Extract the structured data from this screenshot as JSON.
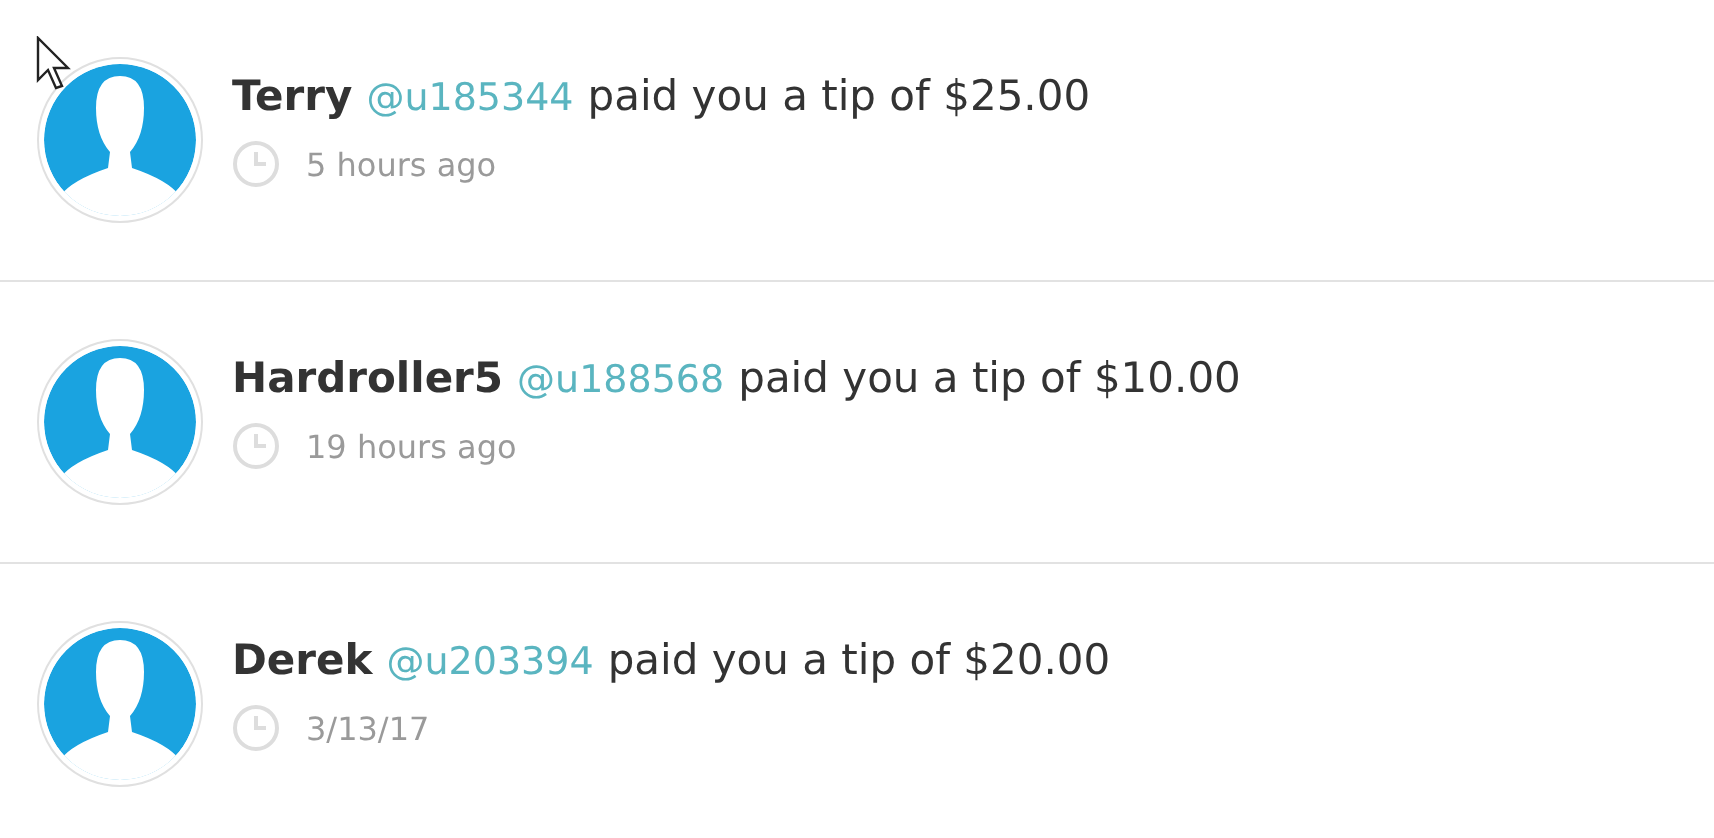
{
  "notifications": [
    {
      "name": "Terry",
      "handle": "@u185344",
      "message": "paid you a tip of $25.00",
      "time": "5 hours ago"
    },
    {
      "name": "Hardroller5",
      "handle": "@u188568",
      "message": "paid you a tip of $10.00",
      "time": "19 hours ago"
    },
    {
      "name": "Derek",
      "handle": "@u203394",
      "message": "paid you a tip of $20.00",
      "time": "3/13/17"
    }
  ]
}
